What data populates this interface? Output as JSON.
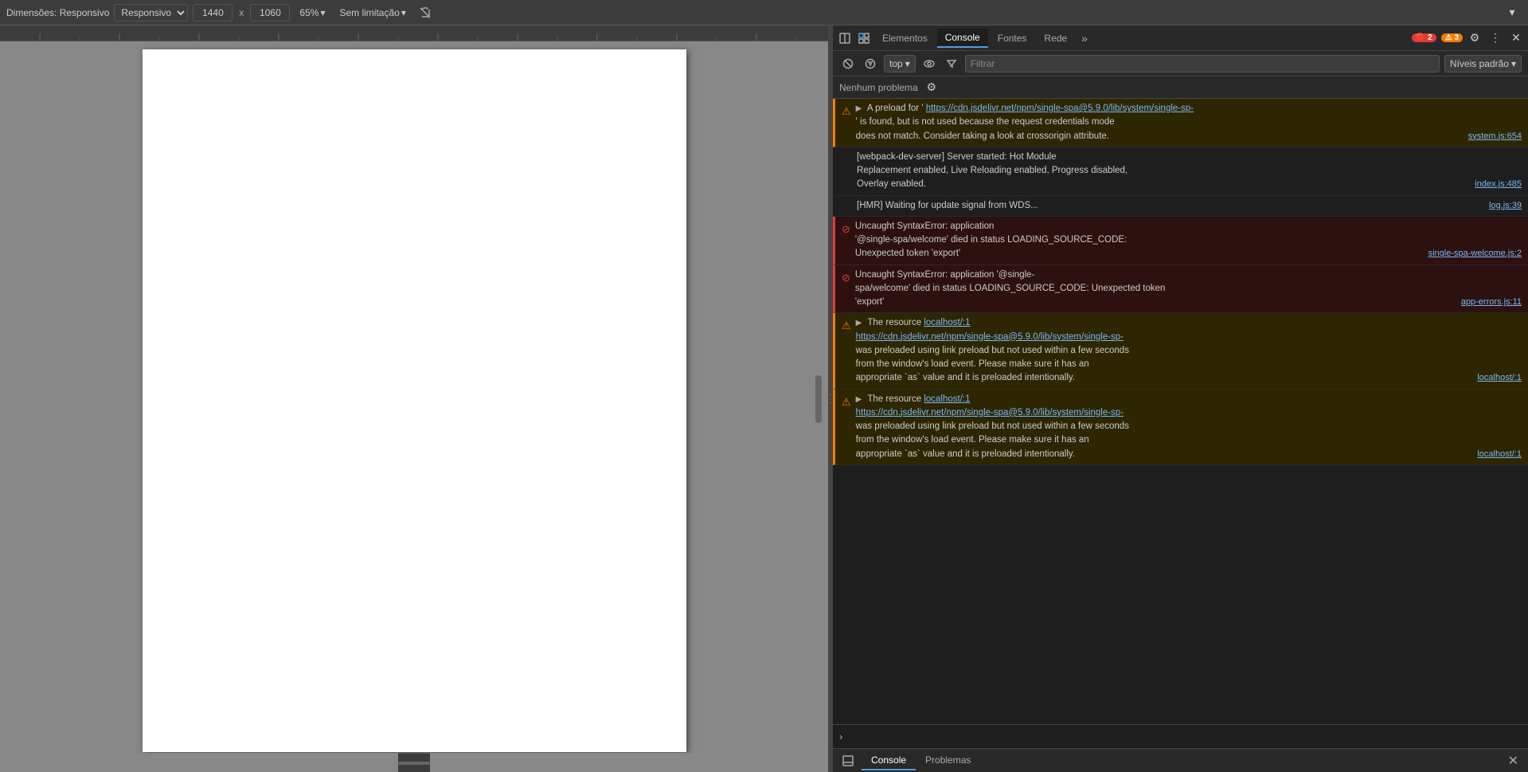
{
  "toolbar": {
    "dimensions_label": "Dimensões: Responsivo",
    "width_value": "1440",
    "height_value": "1060",
    "zoom_value": "65%",
    "throttle_value": "Sem limitação",
    "no_camera_icon": "no-camera"
  },
  "devtools": {
    "tabs": [
      {
        "label": "Elementos",
        "active": false
      },
      {
        "label": "Console",
        "active": true
      },
      {
        "label": "Fontes",
        "active": false
      },
      {
        "label": "Rede",
        "active": false
      }
    ],
    "error_count": "2",
    "warn_count": "3",
    "overflow_label": "»",
    "context": {
      "value": "top",
      "arrow": "▾"
    },
    "filter_placeholder": "Filtrar",
    "levels_label": "Níveis padrão",
    "no_issues_label": "Nenhum problema",
    "messages": [
      {
        "type": "warn",
        "expand": "▶",
        "text": "A preload for '",
        "link": "https://cdn.jsdelivr.net/npm/single-spa@5.9.0/lib/system/single-sp-",
        "text2": "' is found, but is not used because the request credentials mode\ndoes not match. Consider taking a look at crossorigin attribute.",
        "location": "system.js:654"
      },
      {
        "type": "info",
        "text": "[webpack-dev-server] Server started: Hot Module               index.js:485\nReplacement enabled, Live Reloading enabled, Progress disabled,\nOverlay enabled.",
        "location": "index.js:485"
      },
      {
        "type": "info",
        "text": "[HMR] Waiting for update signal from WDS...",
        "location": "log.js:39"
      },
      {
        "type": "error",
        "expand": "●",
        "text": "Uncaught SyntaxError: application\n'@single-spa/welcome' died in status LOADING_SOURCE_CODE:\nUnexpected token 'export'",
        "location": "single-spa-welcome.js:2"
      },
      {
        "type": "error",
        "expand": "●",
        "text": "Uncaught SyntaxError: application '@single-\nspa/welcome' died in status LOADING_SOURCE_CODE: Unexpected token\n'export'",
        "location": "app-errors.js:11"
      },
      {
        "type": "warn",
        "expand": "▶",
        "text": "The resource",
        "link": "localhost/:1",
        "link2": "https://cdn.jsdelivr.net/npm/single-spa@5.9.0/lib/system/single-sp-",
        "text2": "\nwas preloaded using link preload but not used within a few seconds\nfrom the window's load event. Please make sure it has an\nappropriate `as` value and it is preloaded intentionally.",
        "location": "localhost/:1"
      },
      {
        "type": "warn",
        "expand": "▶",
        "text": "The resource",
        "link": "localhost/:1",
        "link2": "https://cdn.jsdelivr.net/npm/single-spa@5.9.0/lib/system/single-sp-",
        "text2": "\nwas preloaded using link preload but not used within a few seconds\nfrom the window's load event. Please make sure it has an\nappropriate `as` value and it is preloaded intentionally.",
        "location": "localhost/:1"
      }
    ],
    "bottom_tabs": [
      {
        "label": "Console",
        "active": true
      },
      {
        "label": "Problemas",
        "active": false
      }
    ]
  }
}
